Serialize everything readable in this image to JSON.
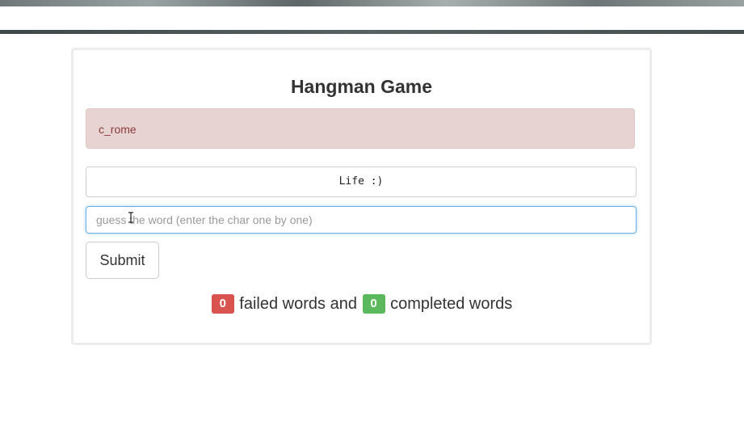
{
  "header": {
    "title": "Hangman Game"
  },
  "word_display": {
    "text": "c_rome"
  },
  "life_status": {
    "text": "Life :)"
  },
  "guess_input": {
    "value": "",
    "placeholder": "guess the word (enter the char one by one)"
  },
  "submit_button": {
    "label": "Submit"
  },
  "score": {
    "failed_count": "0",
    "failed_text": "failed words and",
    "completed_count": "0",
    "completed_text": "completed words"
  },
  "colors": {
    "alert_bg": "#e8d3d3",
    "alert_text": "#8a3b3a",
    "failed_badge": "#d9534f",
    "completed_badge": "#5cb85c",
    "input_focus_border": "#66afe9"
  }
}
